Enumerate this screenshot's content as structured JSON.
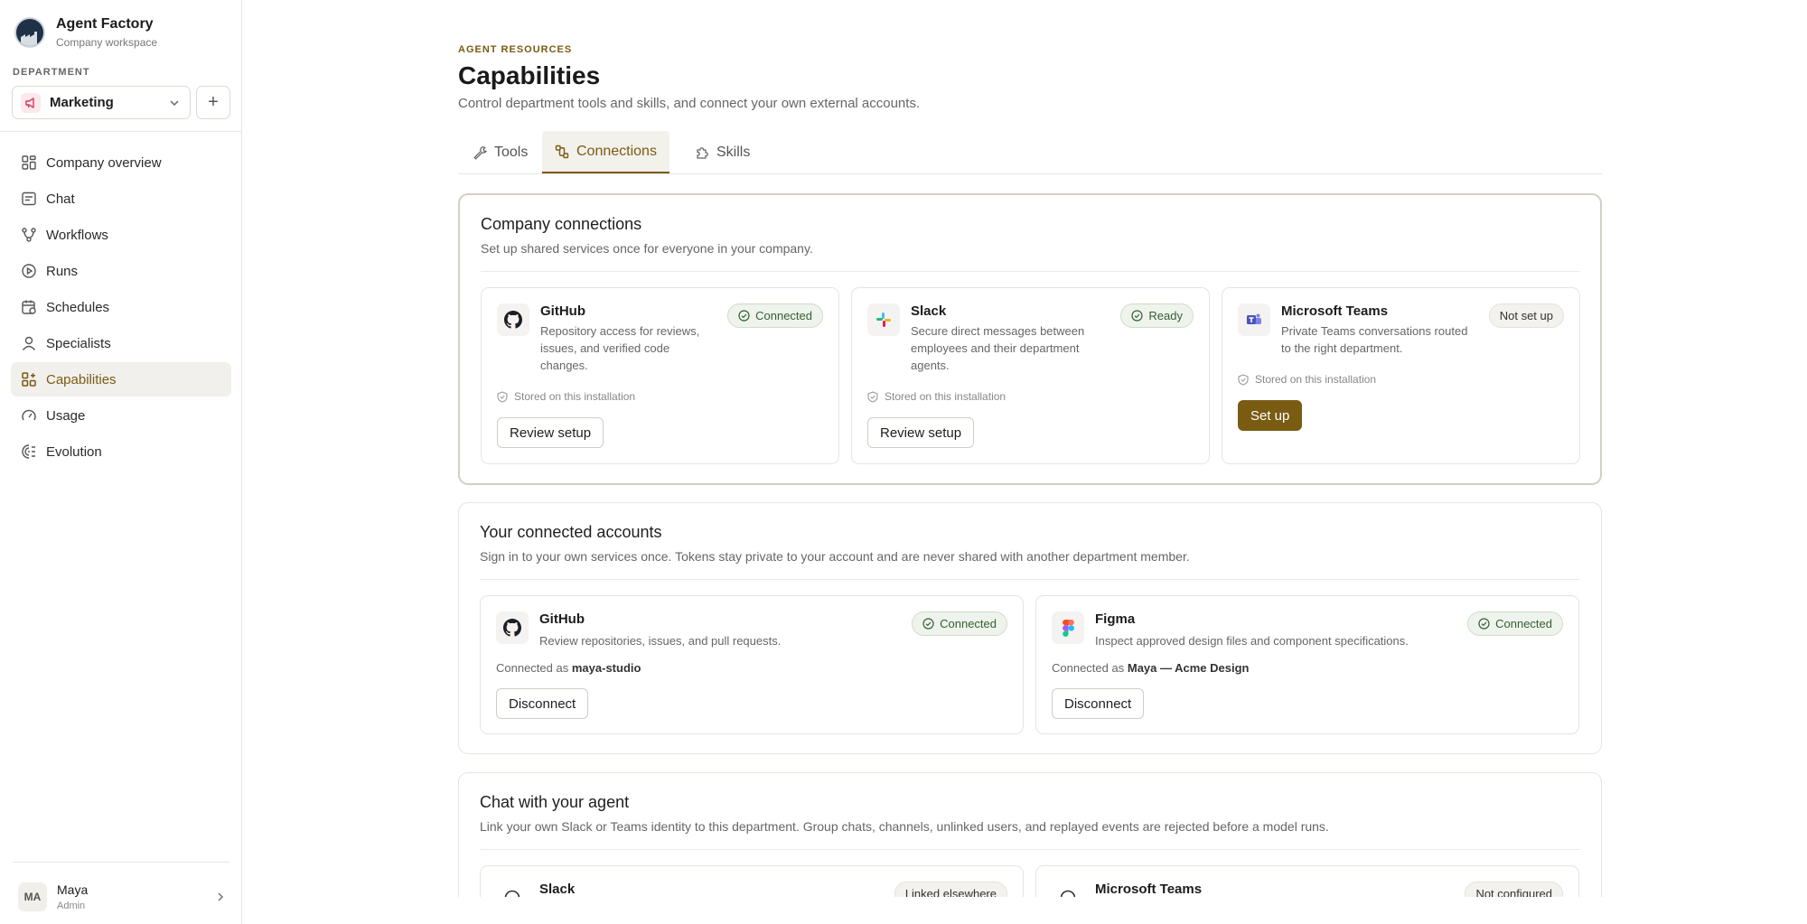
{
  "sidebar": {
    "brand_title": "Agent Factory",
    "brand_subtitle": "Company workspace",
    "department_label": "DEPARTMENT",
    "department_selected": "Marketing",
    "add_label": "+",
    "items": [
      {
        "label": "Company overview",
        "icon": "grid-icon"
      },
      {
        "label": "Chat",
        "icon": "chat-icon"
      },
      {
        "label": "Workflows",
        "icon": "workflow-icon"
      },
      {
        "label": "Runs",
        "icon": "play-icon"
      },
      {
        "label": "Schedules",
        "icon": "calendar-icon"
      },
      {
        "label": "Specialists",
        "icon": "user-icon"
      },
      {
        "label": "Capabilities",
        "icon": "blocks-icon",
        "active": true
      },
      {
        "label": "Usage",
        "icon": "gauge-icon"
      },
      {
        "label": "Evolution",
        "icon": "evolution-icon"
      }
    ],
    "user": {
      "initials": "MA",
      "name": "Maya",
      "role": "Admin"
    }
  },
  "header": {
    "eyebrow": "AGENT RESOURCES",
    "title": "Capabilities",
    "subtitle": "Control department tools and skills, and connect your own external accounts."
  },
  "tabs": [
    {
      "label": "Tools",
      "icon": "wrench-icon"
    },
    {
      "label": "Connections",
      "icon": "connections-icon",
      "active": true
    },
    {
      "label": "Skills",
      "icon": "puzzle-icon"
    }
  ],
  "company_connections": {
    "title": "Company connections",
    "subtitle": "Set up shared services once for everyone in your company.",
    "cards": [
      {
        "name": "GitHub",
        "desc": "Repository access for reviews, issues, and verified code changes.",
        "status": "Connected",
        "stored": "Stored on this installation",
        "action": "Review setup"
      },
      {
        "name": "Slack",
        "desc": "Secure direct messages between employees and their department agents.",
        "status": "Ready",
        "stored": "Stored on this installation",
        "action": "Review setup"
      },
      {
        "name": "Microsoft Teams",
        "desc": "Private Teams conversations routed to the right department.",
        "status": "Not set up",
        "stored": "Stored on this installation",
        "action": "Set up"
      }
    ]
  },
  "your_accounts": {
    "title": "Your connected accounts",
    "subtitle": "Sign in to your own services once. Tokens stay private to your account and are never shared with another department member.",
    "connected_as_label": "Connected as",
    "cards": [
      {
        "name": "GitHub",
        "desc": "Review repositories, issues, and pull requests.",
        "status": "Connected",
        "account": "maya-studio",
        "action": "Disconnect"
      },
      {
        "name": "Figma",
        "desc": "Inspect approved design files and component specifications.",
        "status": "Connected",
        "account": "Maya — Acme Design",
        "action": "Disconnect"
      }
    ]
  },
  "chat_agent": {
    "title": "Chat with your agent",
    "subtitle": "Link your own Slack or Teams identity to this department. Group chats, channels, unlinked users, and replayed events are rejected before a model runs.",
    "cards": [
      {
        "name": "Slack",
        "status": "Linked elsewhere"
      },
      {
        "name": "Microsoft Teams",
        "status": "Not configured"
      }
    ]
  },
  "colors": {
    "accent": "#7a5b12",
    "success": "#356034"
  }
}
